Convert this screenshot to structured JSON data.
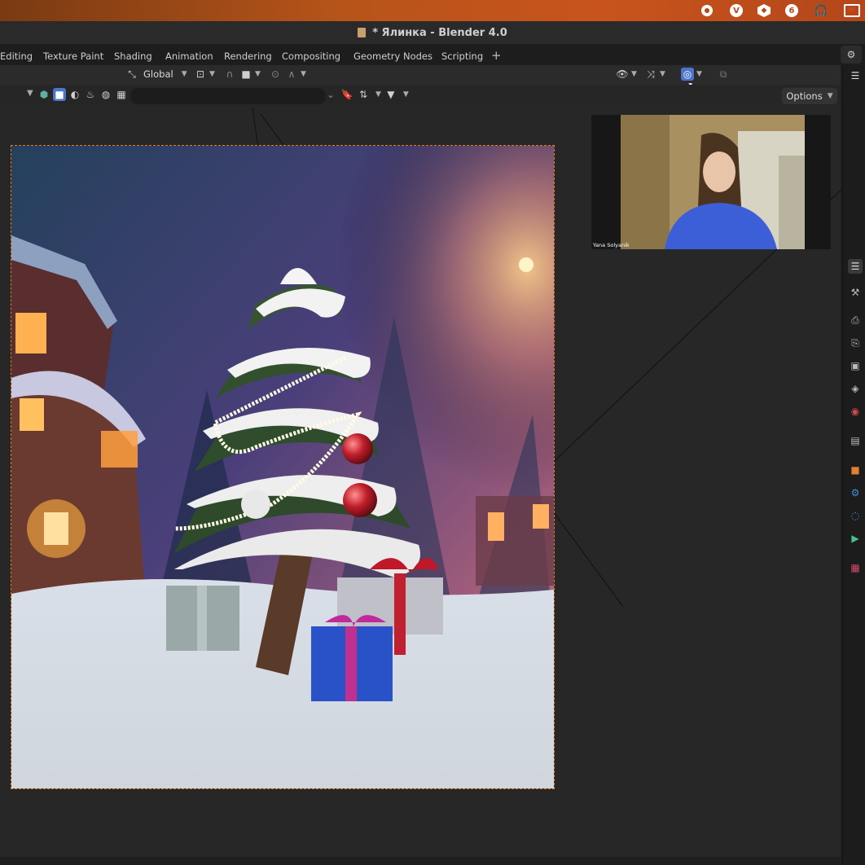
{
  "os_bar": {
    "tray_icons": [
      "record-icon",
      "vpn-icon",
      "package-icon",
      "notification-icon",
      "headphones-icon",
      "display-icon"
    ],
    "notification_count": "6"
  },
  "window": {
    "title": "* Ялинка - Blender 4.0"
  },
  "workspace_tabs": [
    "Editing",
    "Texture Paint",
    "Shading",
    "Animation",
    "Rendering",
    "Compositing",
    "Geometry Nodes",
    "Scripting",
    "+"
  ],
  "header": {
    "transform_orientation": "Global",
    "options_label": "Options",
    "search_value": ""
  },
  "webcam": {
    "participant_name": "Yana Solyanik"
  },
  "colors": {
    "accent": "#4a76c9",
    "render_border": "#e67a2a",
    "os_bar": "#c8541c"
  }
}
